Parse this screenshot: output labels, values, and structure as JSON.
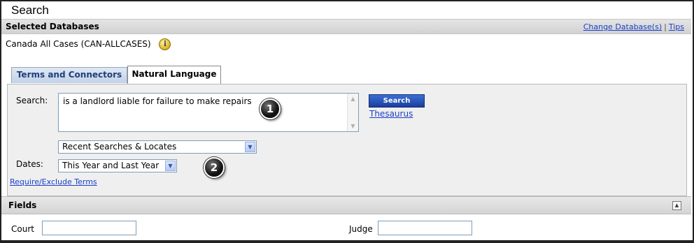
{
  "window": {
    "title": "Search"
  },
  "databases": {
    "header": "Selected Databases",
    "change_link": "Change Database(s)",
    "separator": "|",
    "tips_link": "Tips",
    "selected": "Canada All Cases (CAN-ALLCASES)"
  },
  "tabs": [
    {
      "label": "Terms and Connectors",
      "active": false
    },
    {
      "label": "Natural Language",
      "active": true
    }
  ],
  "search": {
    "label": "Search:",
    "value": "is a landlord liable for failure to make repairs",
    "button": "Search",
    "thesaurus": "Thesaurus"
  },
  "recent_select": {
    "value": "Recent Searches & Locates"
  },
  "dates": {
    "label": "Dates:",
    "value": "This Year and Last Year"
  },
  "require_exclude": "Require/Exclude Terms",
  "callouts": {
    "one": "1",
    "two": "2"
  },
  "fields": {
    "header": "Fields",
    "court_label": "Court",
    "court_value": "",
    "judge_label": "Judge",
    "judge_value": ""
  },
  "colors": {
    "link": "#1a40c8",
    "button": "#1a3e9c",
    "tab_inactive_text": "#1f3f7a"
  }
}
